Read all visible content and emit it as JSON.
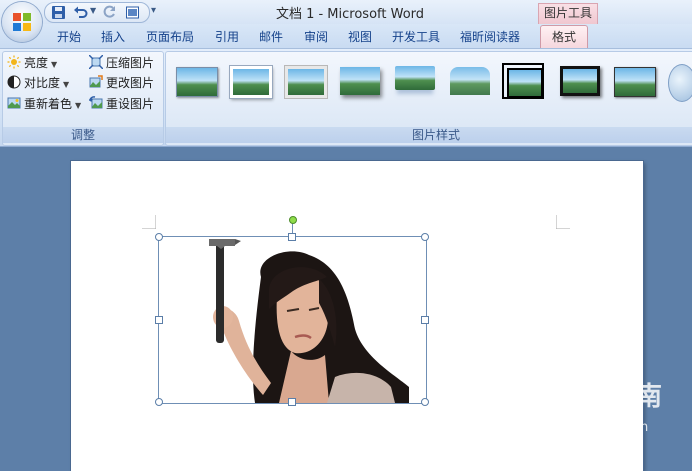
{
  "window": {
    "title": "文档 1 - Microsoft Word",
    "context_tool": "图片工具"
  },
  "tabs": [
    {
      "label": "开始"
    },
    {
      "label": "插入"
    },
    {
      "label": "页面布局"
    },
    {
      "label": "引用"
    },
    {
      "label": "邮件"
    },
    {
      "label": "审阅"
    },
    {
      "label": "视图"
    },
    {
      "label": "开发工具"
    },
    {
      "label": "福昕阅读器"
    },
    {
      "label": "格式",
      "active": true
    }
  ],
  "ribbon": {
    "adjust": {
      "label": "调整",
      "brightness": "亮度",
      "contrast": "对比度",
      "recolor": "重新着色",
      "compress": "压缩图片",
      "change": "更改图片",
      "reset": "重设图片"
    },
    "styles": {
      "label": "图片样式",
      "thumbnail_count": 10
    }
  },
  "watermark": {
    "brand": "搜狗指南",
    "url": "zhinan.sogou.com"
  },
  "colors": {
    "ribbon_text": "#15428b",
    "context_tab": "#f5d6dd",
    "workspace": "#5d7fa8",
    "rotate_handle": "#8fdc4b"
  }
}
